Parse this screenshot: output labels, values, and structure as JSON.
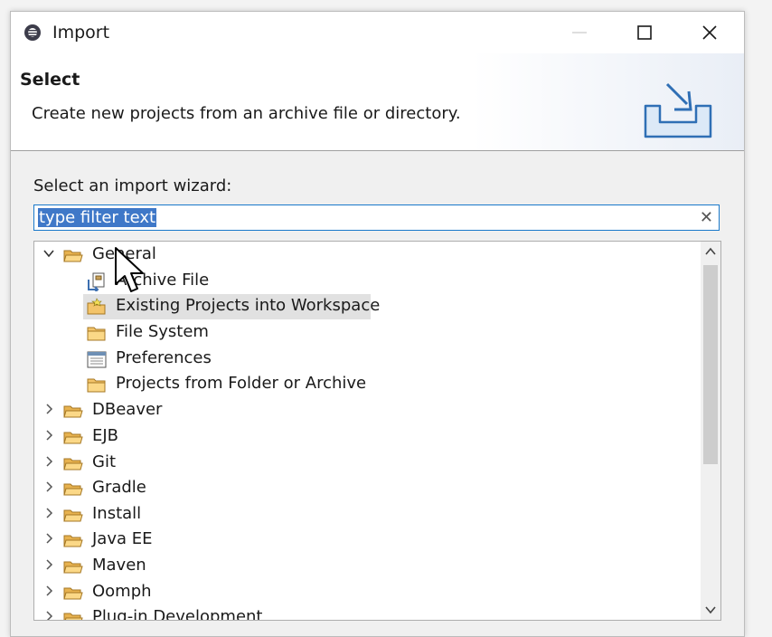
{
  "window": {
    "title": "Import"
  },
  "header": {
    "title": "Select",
    "description": "Create new projects from an archive file or directory."
  },
  "wizard": {
    "label": "Select an import wizard:",
    "filter_text": "type filter text",
    "clear_icon": "clear-icon"
  },
  "tree": {
    "general": {
      "label": "General",
      "children": {
        "archive_file": "Archive File",
        "existing_projects": "Existing Projects into Workspace",
        "file_system": "File System",
        "preferences": "Preferences",
        "projects_from_folder": "Projects from Folder or Archive"
      }
    },
    "categories": {
      "dbeaver": "DBeaver",
      "ejb": "EJB",
      "git": "Git",
      "gradle": "Gradle",
      "install": "Install",
      "java_ee": "Java EE",
      "maven": "Maven",
      "oomph": "Oomph",
      "plugin_dev": "Plug-in Development"
    },
    "selected": "Existing Projects into Workspace"
  },
  "scrollbar": {
    "position": 0.0
  },
  "colors": {
    "selection": "#3f78c8",
    "focus_border": "#1979ca",
    "tree_selection": "#e1e1e1",
    "folder": "#f3c46a"
  }
}
